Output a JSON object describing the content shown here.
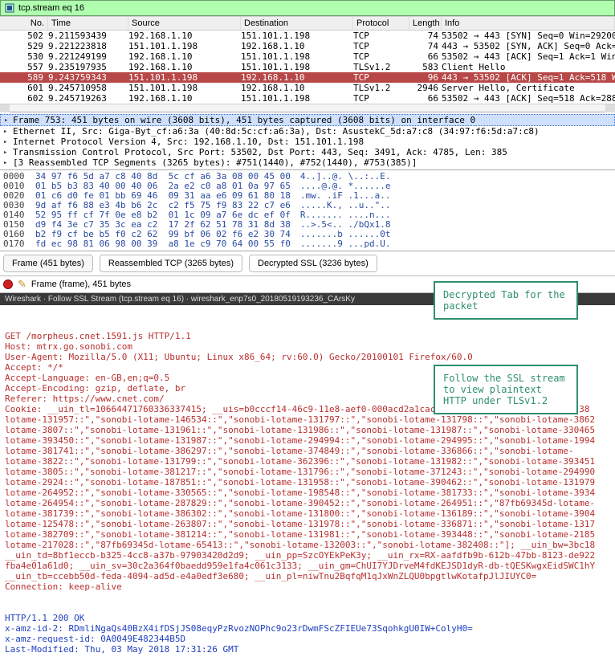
{
  "filter": {
    "text": "tcp.stream eq 16"
  },
  "packet_columns": {
    "no": "No.",
    "time": "Time",
    "src": "Source",
    "dst": "Destination",
    "proto": "Protocol",
    "len": "Length",
    "info": "Info"
  },
  "packets": [
    {
      "no": "502",
      "time": "9.211593439",
      "src": "192.168.1.10",
      "dst": "151.101.1.198",
      "proto": "TCP",
      "len": "74",
      "info": "53502 → 443 [SYN] Seq=0 Win=29200",
      "sel": false
    },
    {
      "no": "529",
      "time": "9.221223818",
      "src": "151.101.1.198",
      "dst": "192.168.1.10",
      "proto": "TCP",
      "len": "74",
      "info": "443 → 53502 [SYN, ACK] Seq=0 Ack=",
      "sel": false
    },
    {
      "no": "530",
      "time": "9.221249199",
      "src": "192.168.1.10",
      "dst": "151.101.1.198",
      "proto": "TCP",
      "len": "66",
      "info": "53502 → 443 [ACK] Seq=1 Ack=1 Win=",
      "sel": false
    },
    {
      "no": "557",
      "time": "9.235197935",
      "src": "192.168.1.10",
      "dst": "151.101.1.198",
      "proto": "TLSv1.2",
      "len": "583",
      "info": "Client Hello",
      "sel": false
    },
    {
      "no": "589",
      "time": "9.243759343",
      "src": "151.101.1.198",
      "dst": "192.168.1.10",
      "proto": "TCP",
      "len": "96",
      "info": "443 → 53502 [ACK] Seq=1 Ack=518 W",
      "sel": true
    },
    {
      "no": "601",
      "time": "9.245710958",
      "src": "151.101.1.198",
      "dst": "192.168.1.10",
      "proto": "TLSv1.2",
      "len": "2946",
      "info": "Server Hello, Certificate",
      "sel": false
    },
    {
      "no": "602",
      "time": "9.245719263",
      "src": "192.168.1.10",
      "dst": "151.101.1.198",
      "proto": "TCP",
      "len": "66",
      "info": "53502 → 443 [ACK] Seq=518 Ack=288",
      "sel": false
    }
  ],
  "details": [
    {
      "text": "Frame 753: 451 bytes on wire (3608 bits), 451 bytes captured (3608 bits) on interface 0",
      "sel": true
    },
    {
      "text": "Ethernet II, Src: Giga-Byt_cf:a6:3a (40:8d:5c:cf:a6:3a), Dst: AsustekC_5d:a7:c8 (34:97:f6:5d:a7:c8)",
      "sel": false
    },
    {
      "text": "Internet Protocol Version 4, Src: 192.168.1.10, Dst: 151.101.1.198",
      "sel": false
    },
    {
      "text": "Transmission Control Protocol, Src Port: 53502, Dst Port: 443, Seq: 3491, Ack: 4785, Len: 385",
      "sel": false
    },
    {
      "text": "[3 Reassembled TCP Segments (3265 bytes): #751(1440), #752(1440), #753(385)]",
      "sel": false
    }
  ],
  "hex": [
    {
      "addr": "0000",
      "bytes": "34 97 f6 5d a7 c8 40 8d  5c cf a6 3a 08 00 45 00",
      "ascii": "4..]..@. \\..:..E."
    },
    {
      "addr": "0010",
      "bytes": "01 b5 b3 83 40 00 40 06  2a e2 c0 a8 01 0a 97 65",
      "ascii": "....@.@. *......e"
    },
    {
      "addr": "0020",
      "bytes": "01 c6 d0 fe 01 bb 69 46  09 31 aa e6 09 61 80 18",
      "ascii": ".mw. .iF .1...a.."
    },
    {
      "addr": "0030",
      "bytes": "9d af f6 88 e3 4b b6 2c  c2 f5 75 f9 83 22 c7 e6",
      "ascii": ".....K., ..u..\".."
    },
    {
      "addr": "0140",
      "bytes": "52 95 ff cf 7f 0e e8 b2  01 1c 09 a7 6e dc ef 0f",
      "ascii": "R....... ....n..."
    },
    {
      "addr": "0150",
      "bytes": "d9 f4 3e c7 35 3c ea c2  17 2f 62 51 78 31 8d 38",
      "ascii": "..>.5<.. ./bQx1.8"
    },
    {
      "addr": "0160",
      "bytes": "b2 f9 cf be b5 f0 c2 62  99 bf 06 02 f6 e2 30 74",
      "ascii": ".......b ......0t"
    },
    {
      "addr": "0170",
      "bytes": "fd ec 98 81 06 98 00 39  a8 1e c9 70 64 00 55 f0",
      "ascii": ".......9 ...pd.U."
    }
  ],
  "tabs": {
    "frame": "Frame (451 bytes)",
    "reasm": "Reassembled TCP (3265 bytes)",
    "decrypted": "Decrypted SSL (3236 bytes)"
  },
  "status_text": "Frame (frame), 451 bytes",
  "footer": "Wireshark · Follow SSL Stream (tcp.stream eq 16) · wireshark_enp7s0_20180519193236_CArsKy",
  "callouts": {
    "c1": "Decrypted Tab for the packet",
    "c2": "Follow the SSL stream to view plaintext HTTP under TLSv1.2"
  },
  "http_request": "GET /morpheus.cnet.1591.js HTTP/1.1\nHost: mtrx.go.sonobi.com\nUser-Agent: Mozilla/5.0 (X11; Ubuntu; Linux x86_64; rv:60.0) Gecko/20100101 Firefox/60.0\nAccept: */*\nAccept-Language: en-GB,en;q=0.5\nAccept-Encoding: gzip, deflate, br\nReferer: https://www.cnet.com/\nCookie: __uin_tl=1066447176033633741​5; __uis=b0cccf14-46c9-11e8-aef0-000acd2a1cac; __uir_tm=[\"sonobi-lotame-38\nlotame-131957::\",\"sonobi-lotame-146534::\",\"sonobi-lotame-131797::\",\"sonobi-lotame-131798::\",\"sonobi-lotame-3862\nlotame-3807::\",\"sonobi-lotame-131961::\",\"sonobi-lotame-131986::\",\"sonobi-lotame-131987::\",\"sonobi-lotame-330465\nlotame-393450::\",\"sonobi-lotame-131987::\",\"sonobi-lotame-294994::\",\"sonobi-lotame-294995::\",\"sonobi-lotame-1994\nlotame-381741::\",\"sonobi-lotame-386297::\",\"sonobi-lotame-374849::\",\"sonobi-lotame-336866::\",\"sonobi-lotame-\nlotame-3822::\",\"sonobi-lotame-131799::\",\"sonobi-lotame-362396::\",\"sonobi-lotame-131982::\",\"sonobi-lotame-393451\nlotame-3805::\",\"sonobi-lotame-381217::\",\"sonobi-lotame-131796::\",\"sonobi-lotame-371243::\",\"sonobi-lotame-294990\nlotame-2924::\",\"sonobi-lotame-187851::\",\"sonobi-lotame-131958::\",\"sonobi-lotame-390462::\",\"sonobi-lotame-131979\nlotame-264952::\",\"sonobi-lotame-330565::\",\"sonobi-lotame-198548::\",\"sonobi-lotame-381733::\",\"sonobi-lotame-3934\nlotame-264954::\",\"sonobi-lotame-287829::\",\"sonobi-lotame-390452::\",\"sonobi-lotame-264951::\",\"87fb69345d-lotame-\nlotame-381739::\",\"sonobi-lotame-386302::\",\"sonobi-lotame-131800::\",\"sonobi-lotame-136189::\",\"sonobi-lotame-3904\nlotame-125478::\",\"sonobi-lotame-263807::\",\"sonobi-lotame-131978::\",\"sonobi-lotame-336871::\",\"sonobi-lotame-1317\nlotame-382709::\",\"sonobi-lotame-381214::\",\"sonobi-lotame-131981::\",\"sonobi-lotame-393448::\",\"sonobi-lotame-2185\nlotame-217028::\",\"87fb69345d-lotame-65413::\",\"sonobi-lotame-132003::\",\"sonobi-lotame-382408::\"]; __uin_bw=3bc18\n__uin_td=8bf1eccb-b325-4cc8-a37b-97903420d2d9; __uin_pp=SzcOYEkPeK3y; __uin_rx=RX-aafdfb9b-612b-47bb-8123-de922\nfba4e01a61d0; __uin_sv=30c2a364f0baedd959e1fa4c061c3133; __uin_gm=ChUI7YJDrveM4fdKEJSD1dyR-db-tQESKwgxEidSWC1hY\n__uin_tb=ccebb50d-feda-4094-ad5d-e4a0edf3e680; __uin_pl=niwTnu2BqfqM1qJxWnZLQU0bpgtlwKotafpJlJIUYC0=\nConnection: keep-alive\n",
  "http_response": "HTTP/1.1 200 OK\nx-amz-id-2: RDmliNgaQs40BzX4ifDSjJS08eqyPzRvozNOPhc9o23rDwmFScZFIEUe73SqohkgU0IW+ColyH0=\nx-amz-request-id: 0A0049E482344B5D\nLast-Modified: Thu, 03 May 2018 17:31:26 GMT"
}
